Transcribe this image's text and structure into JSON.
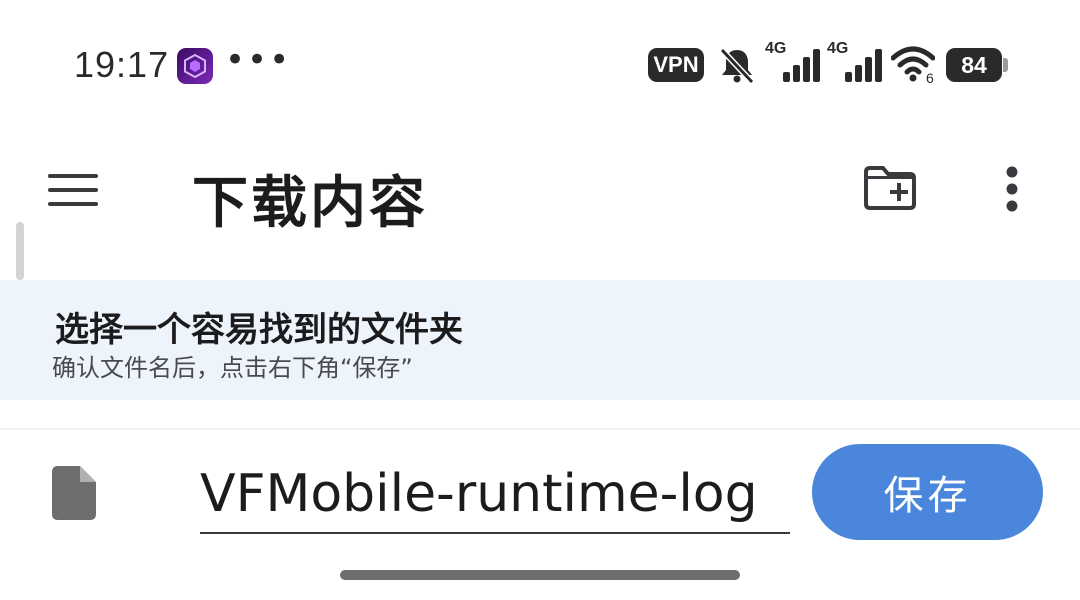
{
  "status_bar": {
    "time": "19:17",
    "app_icon": "hexagon-app-icon",
    "more": "•••",
    "vpn": "VPN",
    "mute_icon": "bell-slash-icon",
    "signal_1_label": "4G",
    "signal_2_label": "4G",
    "wifi_icon": "wifi-icon",
    "wifi_sub": "6",
    "battery": "84"
  },
  "app_bar": {
    "menu_icon": "hamburger-menu-icon",
    "title": "下载内容",
    "new_folder_icon": "new-folder-icon",
    "overflow_icon": "more-vert-icon"
  },
  "hint": {
    "title": "选择一个容易找到的文件夹",
    "subtitle": "确认文件名后，点击右下角“保存”"
  },
  "file_row": {
    "file_icon": "document-icon",
    "filename": "VFMobile-runtime-log",
    "save_label": "保存"
  },
  "colors": {
    "banner_bg": "#eef4fb",
    "save_button": "#4a86dc",
    "text_primary": "#1c1c1e"
  }
}
